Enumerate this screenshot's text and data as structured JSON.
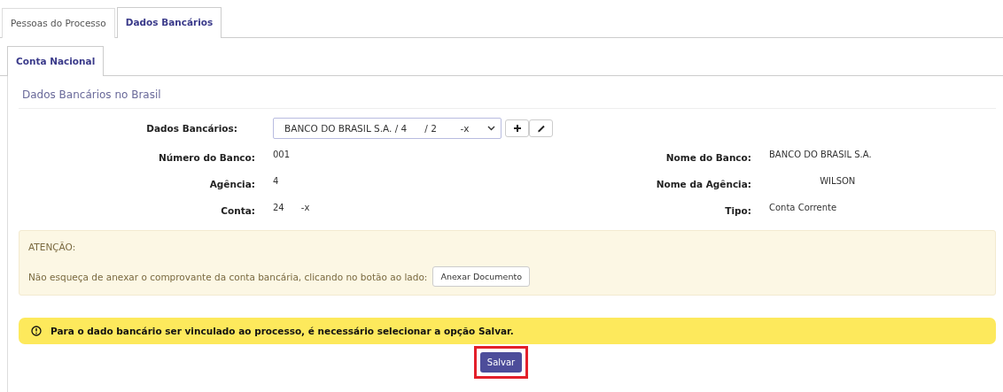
{
  "tabs": [
    {
      "label": "Pessoas do Processo",
      "selected": false
    },
    {
      "label": "Dados Bancários",
      "selected": true
    }
  ],
  "subtabs": [
    {
      "label": "Conta Nacional",
      "selected": true
    }
  ],
  "section_title": "Dados Bancários no Brasil",
  "bank_select": {
    "label": "Dados Bancários:",
    "value": "BANCO DO BRASIL S.A. / 4      / 2        -x"
  },
  "fields": [
    {
      "label": "Número do Banco:",
      "value": "001"
    },
    {
      "label": "Nome do Banco:",
      "value": "BANCO DO BRASIL S.A."
    },
    {
      "label": "Agência:",
      "value": "4"
    },
    {
      "label": "Nome da Agência:",
      "value": "                  WILSON"
    },
    {
      "label": "Conta:",
      "value": "24      -x"
    },
    {
      "label": "Tipo:",
      "value": "Conta Corrente"
    }
  ],
  "attention": {
    "title": "ATENÇÃO:",
    "text": "Não esqueça de anexar o comprovante da conta bancária, clicando no botão ao lado:",
    "button": "Anexar Documento"
  },
  "warning": {
    "text": "Para o dado bancário ser vinculado ao processo, é necessário selecionar a opção Salvar."
  },
  "save_button": {
    "label": "Salvar",
    "highlighted": true
  }
}
